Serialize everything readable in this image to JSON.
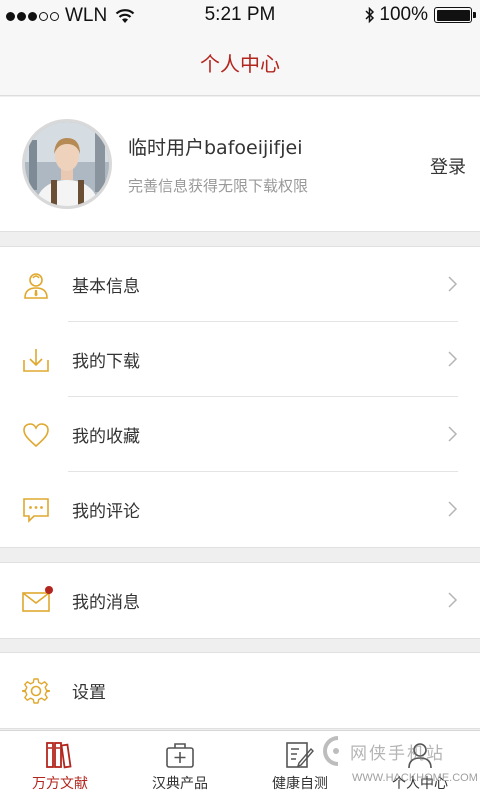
{
  "status_bar": {
    "carrier": "WLN",
    "time": "5:21 PM",
    "battery": "100%",
    "battery_level": 1.0
  },
  "nav": {
    "title": "个人中心"
  },
  "profile": {
    "username": "临时用户bafoeijifjei",
    "subtitle": "完善信息获得无限下载权限",
    "login_label": "登录"
  },
  "menu_groups": [
    {
      "items": [
        {
          "label": "基本信息",
          "icon": "person-icon"
        },
        {
          "label": "我的下载",
          "icon": "download-icon"
        },
        {
          "label": "我的收藏",
          "icon": "heart-icon"
        },
        {
          "label": "我的评论",
          "icon": "comment-icon"
        }
      ]
    },
    {
      "items": [
        {
          "label": "我的消息",
          "icon": "mail-icon",
          "badge": true
        }
      ]
    },
    {
      "items": [
        {
          "label": "设置",
          "icon": "gear-icon"
        }
      ]
    }
  ],
  "tabs": [
    {
      "label": "万方文献",
      "icon": "books-icon",
      "active": true
    },
    {
      "label": "汉典产品",
      "icon": "medkit-icon",
      "active": false
    },
    {
      "label": "健康自测",
      "icon": "edit-icon",
      "active": false
    },
    {
      "label": "个人中心",
      "icon": "user-icon",
      "active": false
    }
  ],
  "watermark": {
    "name": "网侠手机站",
    "url": "WWW.HACKHOME.COM"
  },
  "colors": {
    "accent": "#b3261e",
    "icon_gold": "#e0a82e",
    "badge": "#b3261e"
  }
}
